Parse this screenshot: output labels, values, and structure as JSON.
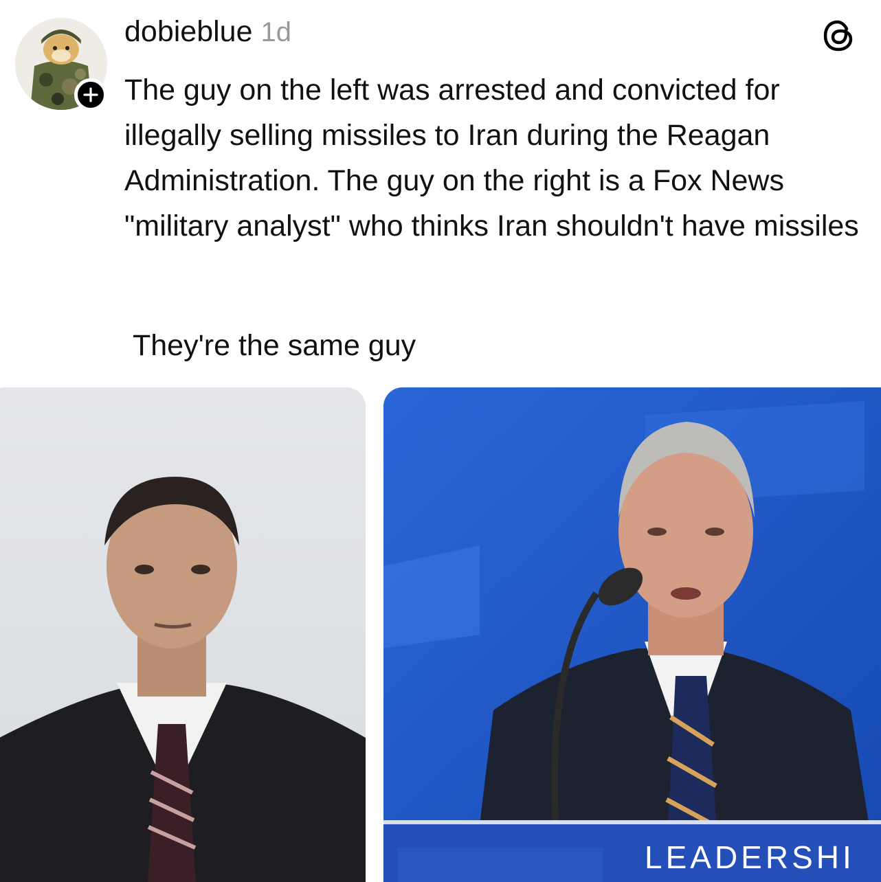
{
  "post": {
    "username": "dobieblue",
    "time": "1d",
    "text": "The guy on the left was arrested and convicted for illegally selling missiles to Iran during the Reagan Administration. The guy on the right is a Fox News \"military analyst\" who thinks Iran shouldn't have missiles",
    "text2": "They're the same guy"
  },
  "icons": {
    "follow": "plus-icon",
    "app": "threads-logo-icon"
  },
  "images": {
    "right_podium_text": "LEADERSHI"
  }
}
